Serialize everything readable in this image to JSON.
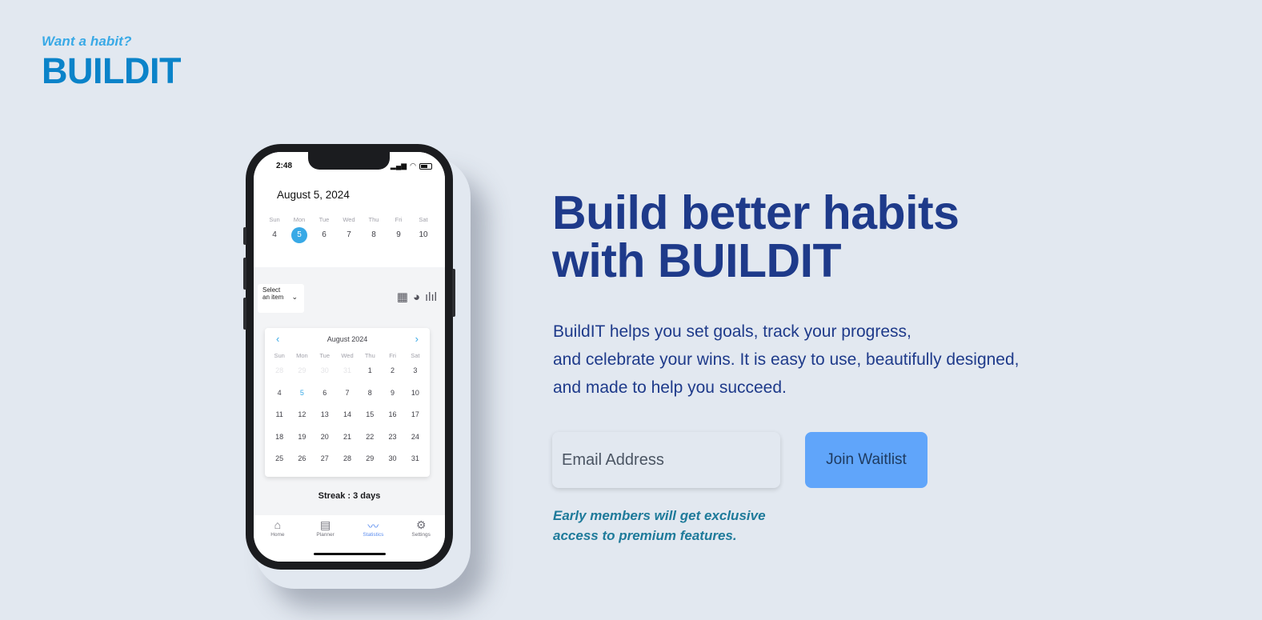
{
  "brand": {
    "tagline": "Want a habit?",
    "logo": "BUILDIT"
  },
  "phone": {
    "time": "2:48",
    "date_title": "August 5, 2024",
    "week": [
      {
        "name": "Sun",
        "day": "4"
      },
      {
        "name": "Mon",
        "day": "5",
        "selected": true
      },
      {
        "name": "Tue",
        "day": "6"
      },
      {
        "name": "Wed",
        "day": "7"
      },
      {
        "name": "Thu",
        "day": "8"
      },
      {
        "name": "Fri",
        "day": "9"
      },
      {
        "name": "Sat",
        "day": "10"
      }
    ],
    "select_label": "Select an item",
    "calendar": {
      "month": "August 2024",
      "weekdays": [
        "Sun",
        "Mon",
        "Tue",
        "Wed",
        "Thu",
        "Fri",
        "Sat"
      ],
      "days": [
        "28",
        "29",
        "30",
        "31",
        "1",
        "2",
        "3",
        "4",
        "5",
        "6",
        "7",
        "8",
        "9",
        "10",
        "11",
        "12",
        "13",
        "14",
        "15",
        "16",
        "17",
        "18",
        "19",
        "20",
        "21",
        "22",
        "23",
        "24",
        "25",
        "26",
        "27",
        "28",
        "29",
        "30",
        "31"
      ]
    },
    "streak": "Streak : 3 days",
    "tabs": [
      {
        "label": "Home",
        "icon": "home-icon"
      },
      {
        "label": "Planner",
        "icon": "calendar-icon"
      },
      {
        "label": "Statistics",
        "icon": "chart-icon",
        "active": true
      },
      {
        "label": "Settings",
        "icon": "gear-icon"
      }
    ]
  },
  "hero": {
    "title_line1": "Build better habits",
    "title_line2": "with BUILDIT",
    "desc_line1": "BuildIT helps you set goals, track your progress,",
    "desc_line2": "and celebrate your wins. It is easy to use, beautifully designed,",
    "desc_line3": "and made to help you succeed."
  },
  "form": {
    "email_placeholder": "Email Address",
    "join_label": "Join Waitlist",
    "note_line1": "Early members will get exclusive",
    "note_line2": "access to premium features."
  },
  "colors": {
    "accent": "#38a9e6",
    "navy": "#1e3a8a",
    "button": "#60a5fa"
  }
}
